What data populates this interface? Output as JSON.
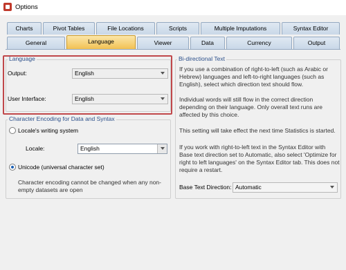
{
  "window": {
    "title": "Options"
  },
  "tabs_row1": [
    "Charts",
    "Pivot Tables",
    "File Locations",
    "Scripts",
    "Multiple Imputations",
    "Syntax Editor"
  ],
  "tabs_row2": [
    "General",
    "Language",
    "Viewer",
    "Data",
    "Currency",
    "Output"
  ],
  "active_tab": "Language",
  "language": {
    "legend": "Language",
    "output_label": "Output:",
    "output_value": "English",
    "ui_label": "User Interface:",
    "ui_value": "English"
  },
  "encoding": {
    "legend": "Character Encoding for Data and Syntax",
    "locale_radio_label": "Locale's writing system",
    "locale_label": "Locale:",
    "locale_value": "English",
    "unicode_radio_label": "Unicode (universal character set)",
    "note": "Character encoding cannot be changed when any non-empty datasets are open",
    "selected": "unicode"
  },
  "bidi": {
    "legend": "Bi-directional Text",
    "para1": "If you use a combination of right-to-left (such as Arabic or Hebrew) languages and left-to-right languages (such as English), select which direction text should flow.",
    "para2": "Individual words will still flow in the correct direction depending on their language. Only overall text runs are affected by this choice.",
    "para3": "This setting will take effect the next time Statistics is started.",
    "para4": "If you work with right-to-left text in the Syntax Editor with Base text direction set to Automatic, also select 'Optimize for right to left languages' on the Syntax Editor tab. This does not require a restart.",
    "base_label": "Base Text Direction:",
    "base_value": "Automatic"
  },
  "colors": {
    "active_tab": "#f2c153",
    "legend_text": "#2b4f8a",
    "highlight": "#c0474a"
  }
}
